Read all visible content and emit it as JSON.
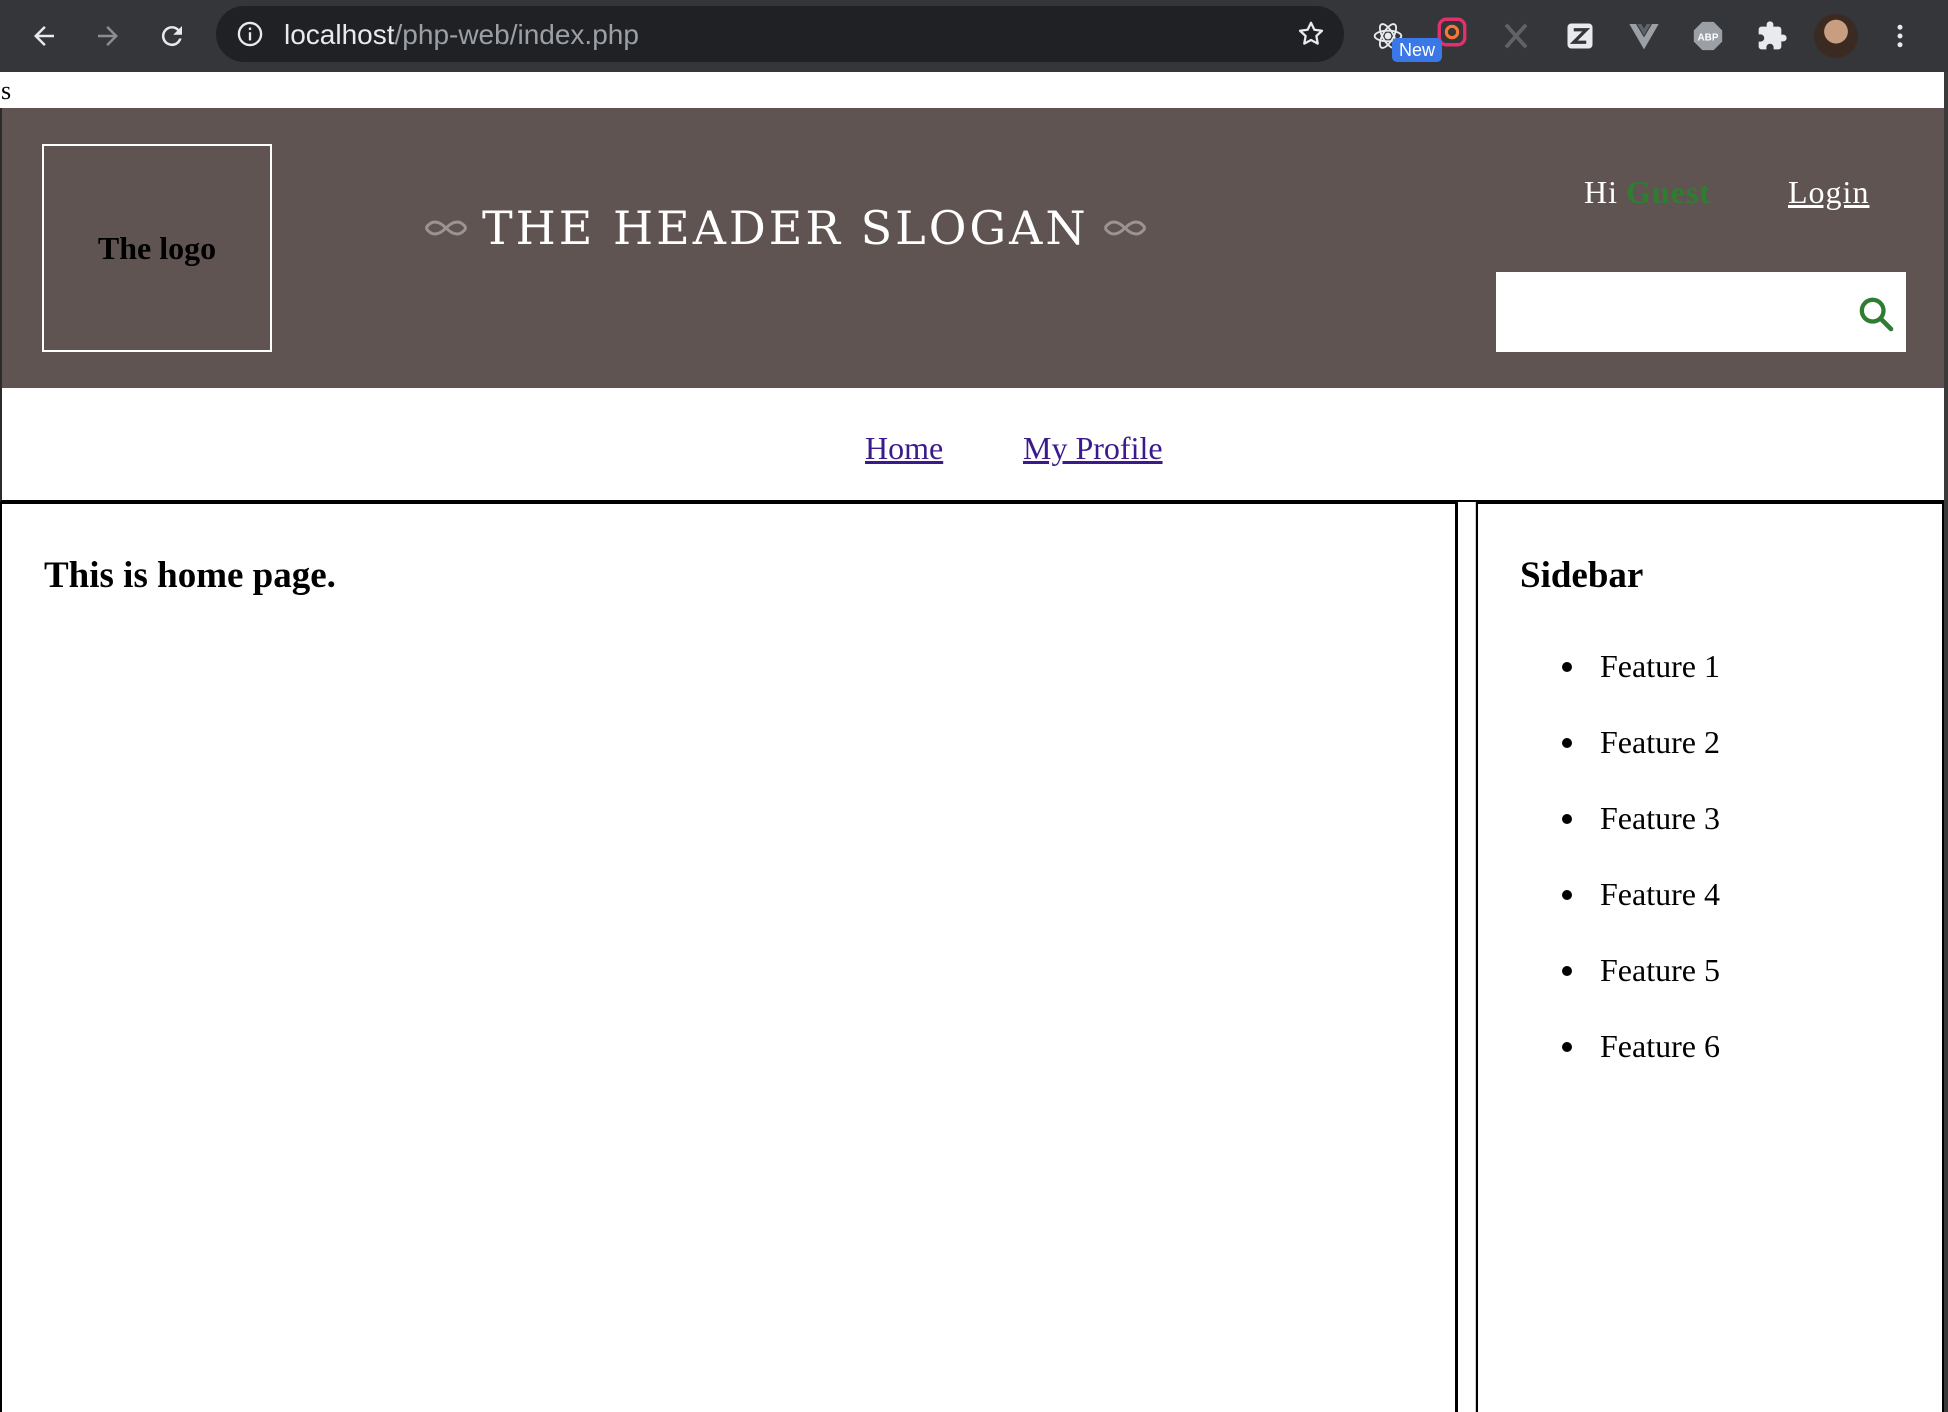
{
  "browser": {
    "url_host": "localhost",
    "url_path": "/php-web/index.php",
    "extension_badge": "New",
    "icons": [
      "back-arrow-icon",
      "forward-arrow-icon",
      "reload-icon",
      "site-info-icon",
      "bookmark-star-icon",
      "react-devtools-icon",
      "extension-icon",
      "x-icon",
      "z-icon",
      "vue-icon",
      "adblock-icon",
      "puzzle-icon",
      "avatar",
      "kebab-menu-icon"
    ],
    "ext_colors": {
      "chrome_bg": "#35363a",
      "url_bg": "#202124"
    }
  },
  "page": {
    "stray_text": "s",
    "header": {
      "logo_text": "The logo",
      "slogan": "THE HEADER SLOGAN",
      "greeting": "Hi",
      "user_name": "Guest",
      "login_label": "Login",
      "search_value": "",
      "colors": {
        "header_bg": "#5f5452",
        "guest": "#2f7d2f"
      }
    },
    "nav": {
      "items": [
        {
          "label": "Home"
        },
        {
          "label": "My Profile"
        }
      ]
    },
    "main": {
      "heading": "This is home page."
    },
    "sidebar": {
      "heading": "Sidebar",
      "features": [
        "Feature 1",
        "Feature 2",
        "Feature 3",
        "Feature 4",
        "Feature 5",
        "Feature 6"
      ]
    }
  }
}
